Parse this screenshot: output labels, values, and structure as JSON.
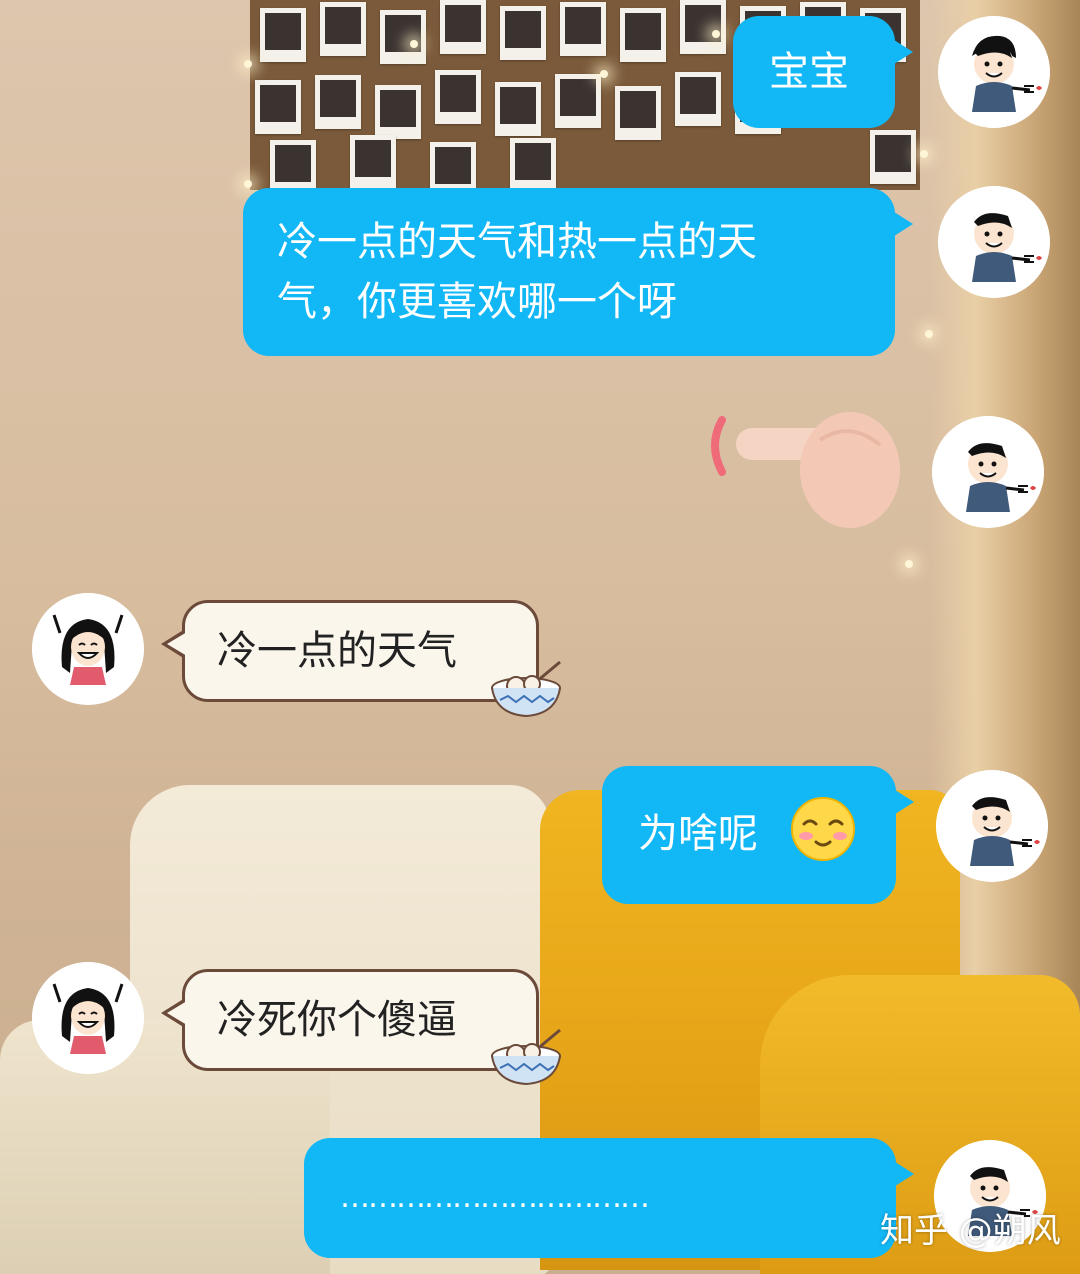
{
  "colors": {
    "sent_bubble": "#12b7f5",
    "received_bubble": "#fbf6ec",
    "received_border": "#6b4a3a"
  },
  "messages": [
    {
      "side": "right",
      "sender": "boy",
      "text": "宝宝"
    },
    {
      "side": "right",
      "sender": "boy",
      "text_lines": [
        "冷一点的天气和热一点的天",
        "气，你更喜欢哪一个呀"
      ]
    },
    {
      "side": "right",
      "sender": "boy",
      "sticker": "poke-finger-sticker"
    },
    {
      "side": "left",
      "sender": "girl",
      "text": "冷一点的天气",
      "decoration": "tangyuan-bowl-icon"
    },
    {
      "side": "right",
      "sender": "boy",
      "text": "为啥呢",
      "emoji": "shy-smile-emoji"
    },
    {
      "side": "left",
      "sender": "girl",
      "text": "冷死你个傻逼",
      "decoration": "tangyuan-bowl-icon"
    },
    {
      "side": "right",
      "sender": "boy",
      "text": "……………………………"
    }
  ],
  "watermark": "知乎 @朔风"
}
